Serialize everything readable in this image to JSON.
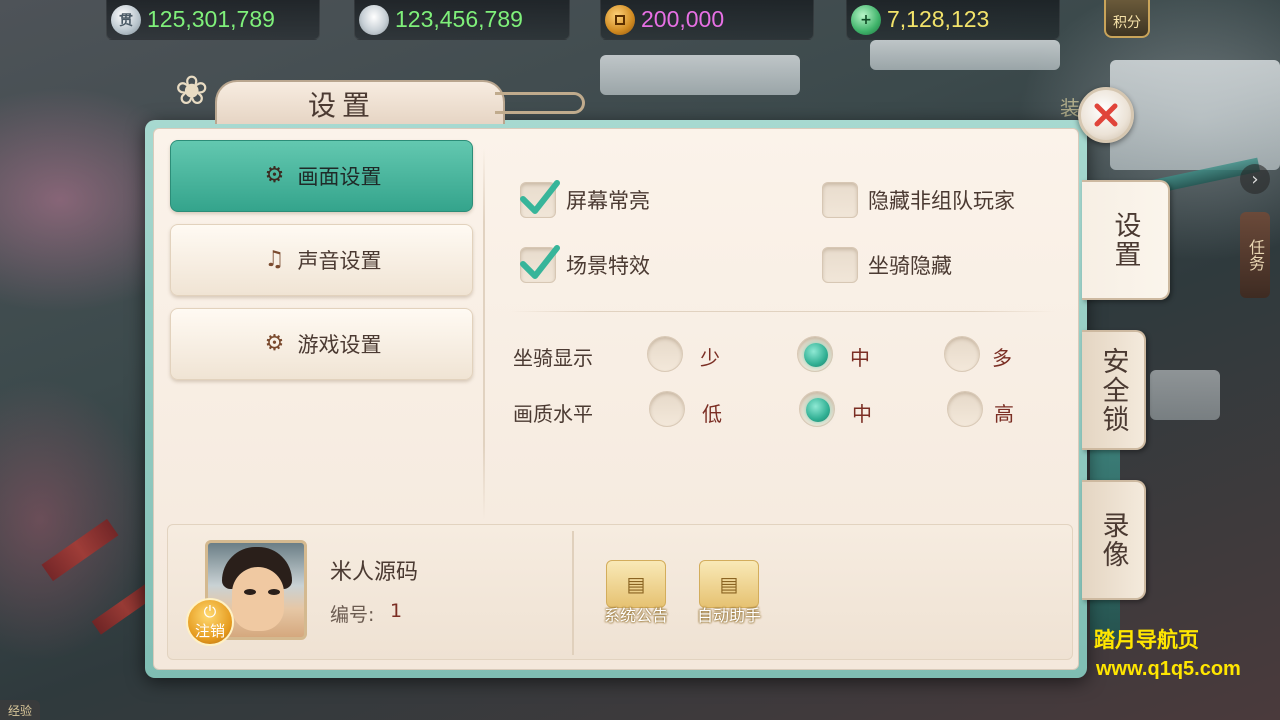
{
  "currency": [
    {
      "icon": "silver-coin-icon",
      "icon_glyph": "贯",
      "value": "125,301,789",
      "color": "#7ff07a"
    },
    {
      "icon": "silver-ingot-icon",
      "icon_glyph": "",
      "value": "123,456,789",
      "color": "#7ff07a"
    },
    {
      "icon": "copper-coin-icon",
      "icon_glyph": "",
      "value": "200,000",
      "color": "#e770e4"
    },
    {
      "icon": "jade-icon",
      "icon_glyph": "+",
      "value": "7,128,123",
      "color": "#f2e36a"
    }
  ],
  "score_button": "积分",
  "window": {
    "title": "设置"
  },
  "menu": [
    {
      "label": "画面设置",
      "icon": "gears-icon",
      "active": true
    },
    {
      "label": "声音设置",
      "icon": "music-note-icon",
      "active": false
    },
    {
      "label": "游戏设置",
      "icon": "gamepad-gears-icon",
      "active": false
    }
  ],
  "checkboxes": [
    {
      "label": "屏幕常亮",
      "checked": true
    },
    {
      "label": "隐藏非组队玩家",
      "checked": false
    },
    {
      "label": "场景特效",
      "checked": true
    },
    {
      "label": "坐骑隐藏",
      "checked": false
    }
  ],
  "radio_groups": [
    {
      "label": "坐骑显示",
      "options": [
        "少",
        "中",
        "多"
      ],
      "selected": "中"
    },
    {
      "label": "画质水平",
      "options": [
        "低",
        "中",
        "高"
      ],
      "selected": "中"
    }
  ],
  "player": {
    "name": "米人源码",
    "id_label": "编号:",
    "id_value": "1",
    "logout_label": "注销"
  },
  "function_buttons": [
    {
      "label": "系统公告",
      "icon": "scroll-icon"
    },
    {
      "label": "自动助手",
      "icon": "scroll-icon"
    }
  ],
  "side_tabs": [
    {
      "label": "设置",
      "active": true
    },
    {
      "label": "安全锁",
      "active": false
    },
    {
      "label": "录像",
      "active": false
    }
  ],
  "hud": {
    "task_tab": "任务",
    "exp_label": "经验",
    "background_sign": "装 板"
  },
  "watermark": {
    "line1": "踏月导航页",
    "line2": "www.q1q5.com"
  },
  "colors": {
    "accent_teal": "#34a48c",
    "text_dark": "#4b3a32",
    "option_red": "#7b2e24"
  }
}
